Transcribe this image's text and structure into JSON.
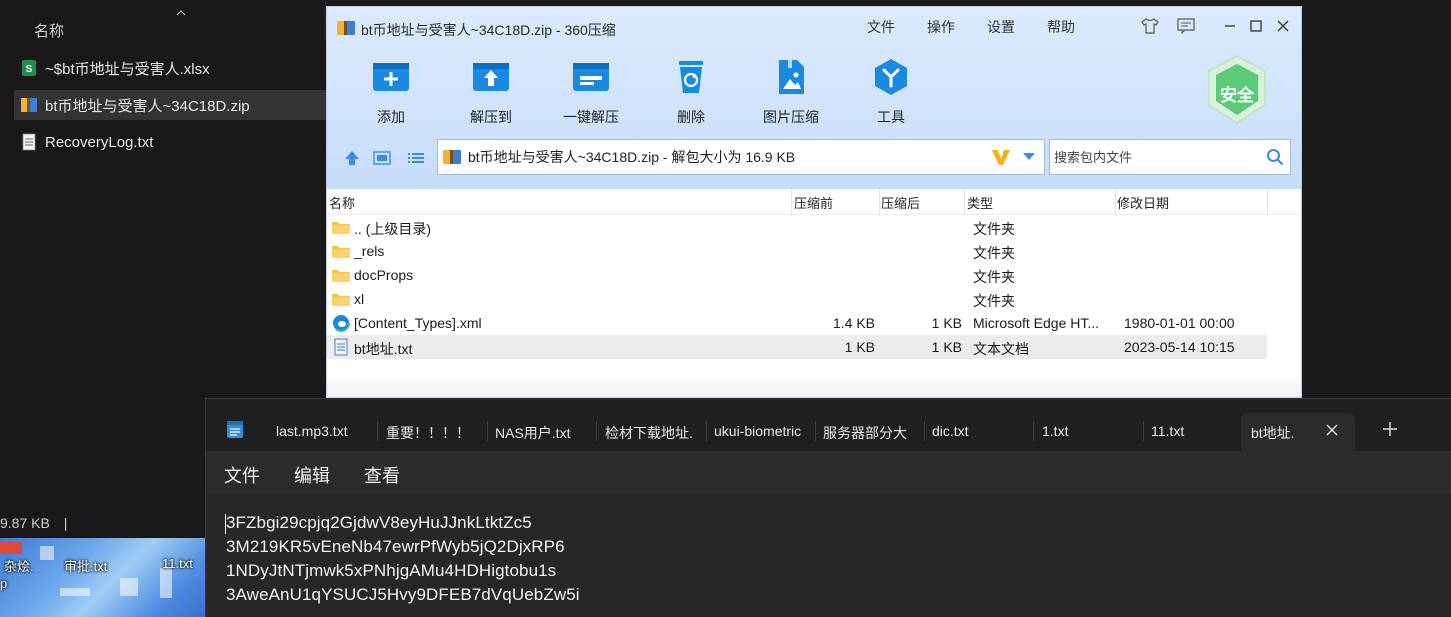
{
  "explorer": {
    "column_header": "名称",
    "files": [
      {
        "name": "~$bt币地址与受害人.xlsx",
        "icon": "excel-icon"
      },
      {
        "name": "bt币地址与受害人~34C18D.zip",
        "icon": "zip-icon",
        "selected": true
      },
      {
        "name": "RecoveryLog.txt",
        "icon": "text-file-icon"
      }
    ],
    "status": "9.87 KB",
    "status_sep": "|"
  },
  "desktop": {
    "labels": [
      "杂烩.",
      "审批.txt",
      "11.txt"
    ],
    "extra": "p"
  },
  "zip": {
    "title": "bt币地址与受害人~34C18D.zip - 360压缩",
    "menu": [
      "文件",
      "操作",
      "设置",
      "帮助"
    ],
    "toolbar": [
      "添加",
      "解压到",
      "一键解压",
      "删除",
      "图片压缩",
      "工具"
    ],
    "safe_badge": "安全",
    "address": "bt币地址与受害人~34C18D.zip - 解包大小为 16.9 KB",
    "search_placeholder": "搜索包内文件",
    "columns": {
      "name": "名称",
      "size": "压缩前",
      "compressed": "压缩后",
      "type": "类型",
      "date": "修改日期"
    },
    "rows": [
      {
        "name": ".. (上级目录)",
        "size": "",
        "compressed": "",
        "type": "文件夹",
        "date": "",
        "icon": "folder-icon"
      },
      {
        "name": "_rels",
        "size": "",
        "compressed": "",
        "type": "文件夹",
        "date": "",
        "icon": "folder-icon"
      },
      {
        "name": "docProps",
        "size": "",
        "compressed": "",
        "type": "文件夹",
        "date": "",
        "icon": "folder-icon"
      },
      {
        "name": "xl",
        "size": "",
        "compressed": "",
        "type": "文件夹",
        "date": "",
        "icon": "folder-icon"
      },
      {
        "name": "[Content_Types].xml",
        "size": "1.4 KB",
        "compressed": "1 KB",
        "type": "Microsoft Edge HT...",
        "date": "1980-01-01 00:00",
        "icon": "edge-icon"
      },
      {
        "name": "bt地址.txt",
        "size": "1 KB",
        "compressed": "1 KB",
        "type": "文本文档",
        "date": "2023-05-14 10:15",
        "icon": "text-file-icon",
        "selected": true
      }
    ],
    "colors": {
      "accent": "#1a8ae0",
      "safe": "#46c16a"
    }
  },
  "notepad": {
    "tabs": [
      "last.mp3.txt",
      "重要！！！！",
      "NAS用户.txt",
      "检材下载地址.",
      "ukui-biometric",
      "服务器部分大",
      "dic.txt",
      "1.txt",
      "11.txt",
      "bt地址."
    ],
    "active_tab": 9,
    "menu": [
      "文件",
      "编辑",
      "查看"
    ],
    "lines": [
      "3FZbgi29cpjq2GjdwV8eyHuJJnkLtktZc5",
      "3M219KR5vEneNb47ewrPfWyb5jQ2DjxRP6",
      "1NDyJtNTjmwk5xPNhjgAMu4HDHigtobu1s",
      "3AweAnU1qYSUCJ5Hvy9DFEB7dVqUebZw5i"
    ]
  }
}
